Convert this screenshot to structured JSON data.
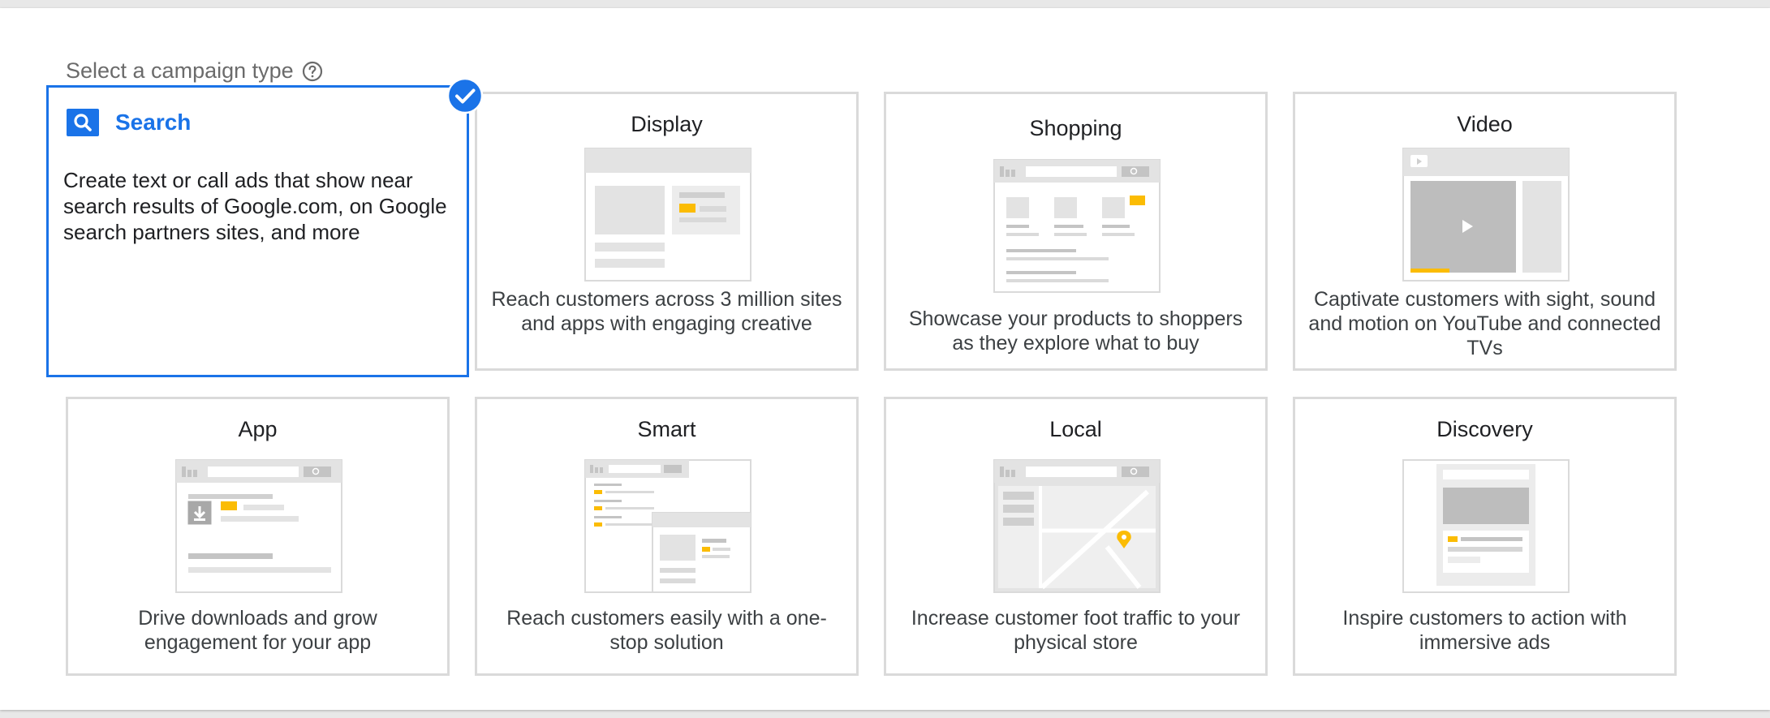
{
  "heading": {
    "label": "Select a campaign type"
  },
  "colors": {
    "accent": "#1a73e8",
    "highlight": "#fbbc04",
    "placeholder": "#d6d6d6"
  },
  "campaign_types": [
    {
      "id": "search",
      "title": "Search",
      "description": "Create text or call ads that show near search results of Google.com, on Google search partners sites, and more",
      "selected": true,
      "icon": "search-icon"
    },
    {
      "id": "display",
      "title": "Display",
      "description": "Reach customers across 3 million sites and apps with engaging creative",
      "selected": false
    },
    {
      "id": "shopping",
      "title": "Shopping",
      "description": "Showcase your products to shoppers as they explore what to buy",
      "selected": false
    },
    {
      "id": "video",
      "title": "Video",
      "description": "Captivate customers with sight, sound and motion on YouTube and connected TVs",
      "selected": false
    },
    {
      "id": "app",
      "title": "App",
      "description": "Drive downloads and grow engagement for your app",
      "selected": false
    },
    {
      "id": "smart",
      "title": "Smart",
      "description": "Reach customers easily with a one-stop solution",
      "selected": false
    },
    {
      "id": "local",
      "title": "Local",
      "description": "Increase customer foot traffic to your physical store",
      "selected": false
    },
    {
      "id": "discovery",
      "title": "Discovery",
      "description": "Inspire customers to action with immersive ads",
      "selected": false
    }
  ]
}
